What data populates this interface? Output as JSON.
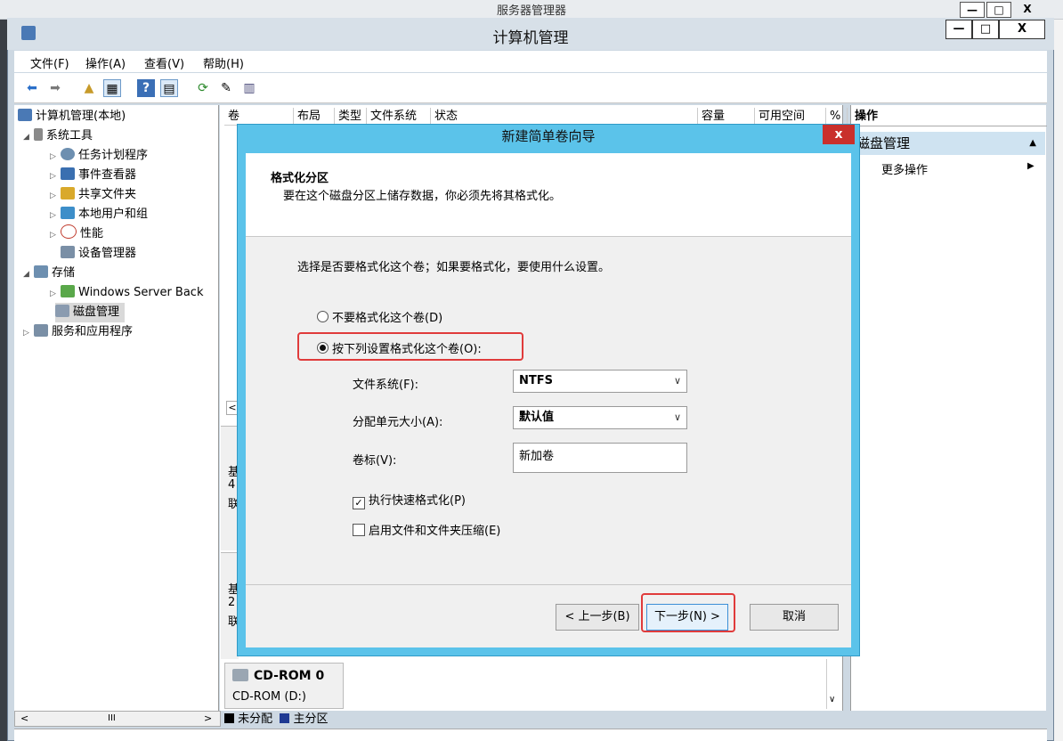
{
  "background_window": {
    "title": "服务器管理器",
    "controls": [
      "—",
      "□",
      "X"
    ]
  },
  "window": {
    "title": "计算机管理",
    "controls": {
      "minimize": "—",
      "maximize": "□",
      "close": "X"
    }
  },
  "menu": [
    "文件(F)",
    "操作(A)",
    "查看(V)",
    "帮助(H)"
  ],
  "toolbar_icons": [
    "back-arrow-icon",
    "forward-arrow-icon",
    "up-folder-icon",
    "show-hide-tree-icon",
    "help-icon",
    "console-icon",
    "refresh-icon",
    "properties-icon",
    "disk-icon"
  ],
  "tree": {
    "root": "计算机管理(本地)",
    "system_tools": "系统工具",
    "task_scheduler": "任务计划程序",
    "event_viewer": "事件查看器",
    "shared_folders": "共享文件夹",
    "local_users": "本地用户和组",
    "performance": "性能",
    "device_manager": "设备管理器",
    "storage": "存储",
    "backup": "Windows Server Back",
    "disk_management": "磁盘管理",
    "services": "服务和应用程序"
  },
  "columns": [
    "卷",
    "布局",
    "类型",
    "文件系统",
    "状态",
    "容量",
    "可用空间",
    "%"
  ],
  "disk_rows": [
    {
      "line1": "基",
      "line2": "4",
      "line3": "联"
    },
    {
      "line1": "基",
      "line2": "2",
      "line3": "联"
    }
  ],
  "cdrom": {
    "name": "CD-ROM 0",
    "label": "CD-ROM (D:)"
  },
  "legend": {
    "unallocated": "未分配",
    "primary": "主分区"
  },
  "scroll": {
    "left": "<",
    "mid": "III",
    "right": ">"
  },
  "actions": {
    "header": "操作",
    "section": "磁盘管理",
    "more": "更多操作"
  },
  "dialog": {
    "title": "新建简单卷向导",
    "close": "x",
    "heading": "格式化分区",
    "subheading": "要在这个磁盘分区上储存数据，你必须先将其格式化。",
    "prompt": "选择是否要格式化这个卷；如果要格式化，要使用什么设置。",
    "option_no_format": "不要格式化这个卷(D)",
    "option_format": "按下列设置格式化这个卷(O):",
    "filesystem_label": "文件系统(F):",
    "filesystem_value": "NTFS",
    "allocation_label": "分配单元大小(A):",
    "allocation_value": "默认值",
    "volume_label": "卷标(V):",
    "volume_value": "新加卷",
    "quick_format": "执行快速格式化(P)",
    "compression": "启用文件和文件夹压缩(E)",
    "back_button": "< 上一步(B)",
    "next_button": "下一步(N) >",
    "cancel_button": "取消"
  },
  "colors": {
    "dialog_frame": "#5bc3ea",
    "highlight_box": "#e03b3b",
    "action_section": "#cfe3f1",
    "primary_partition": "#1f3a93",
    "unallocated": "#000000"
  }
}
